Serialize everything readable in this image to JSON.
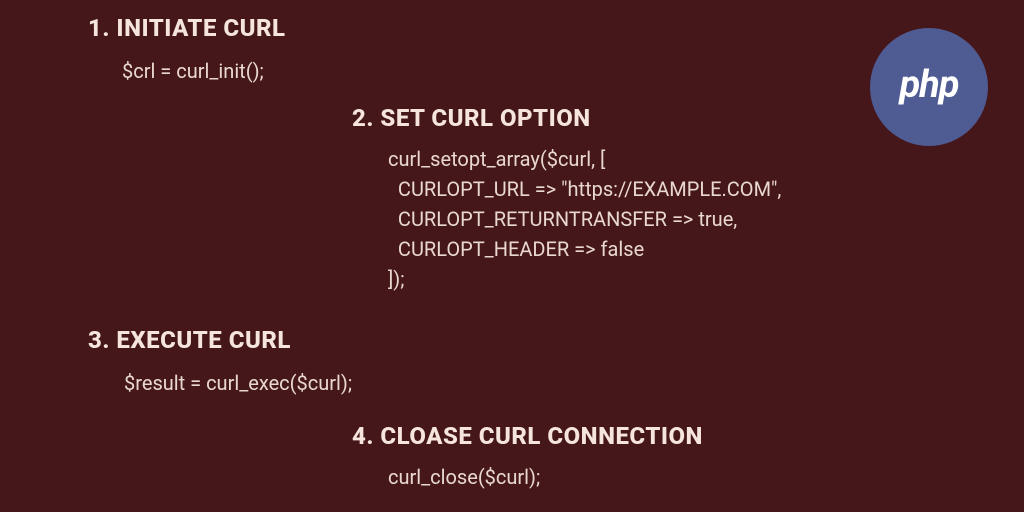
{
  "badge": {
    "label": "php"
  },
  "steps": [
    {
      "heading": "1. INITIATE CURL",
      "code": "$crl = curl_init();"
    },
    {
      "heading": "2. SET CURL OPTION",
      "code": "curl_setopt_array($curl, [\n  CURLOPT_URL => \"https://EXAMPLE.COM\",\n  CURLOPT_RETURNTRANSFER => true,\n  CURLOPT_HEADER => false\n]);"
    },
    {
      "heading": "3. EXECUTE CURL",
      "code": "$result = curl_exec($curl);"
    },
    {
      "heading": "4. CLOASE CURL CONNECTION",
      "code": "curl_close($curl);"
    }
  ]
}
